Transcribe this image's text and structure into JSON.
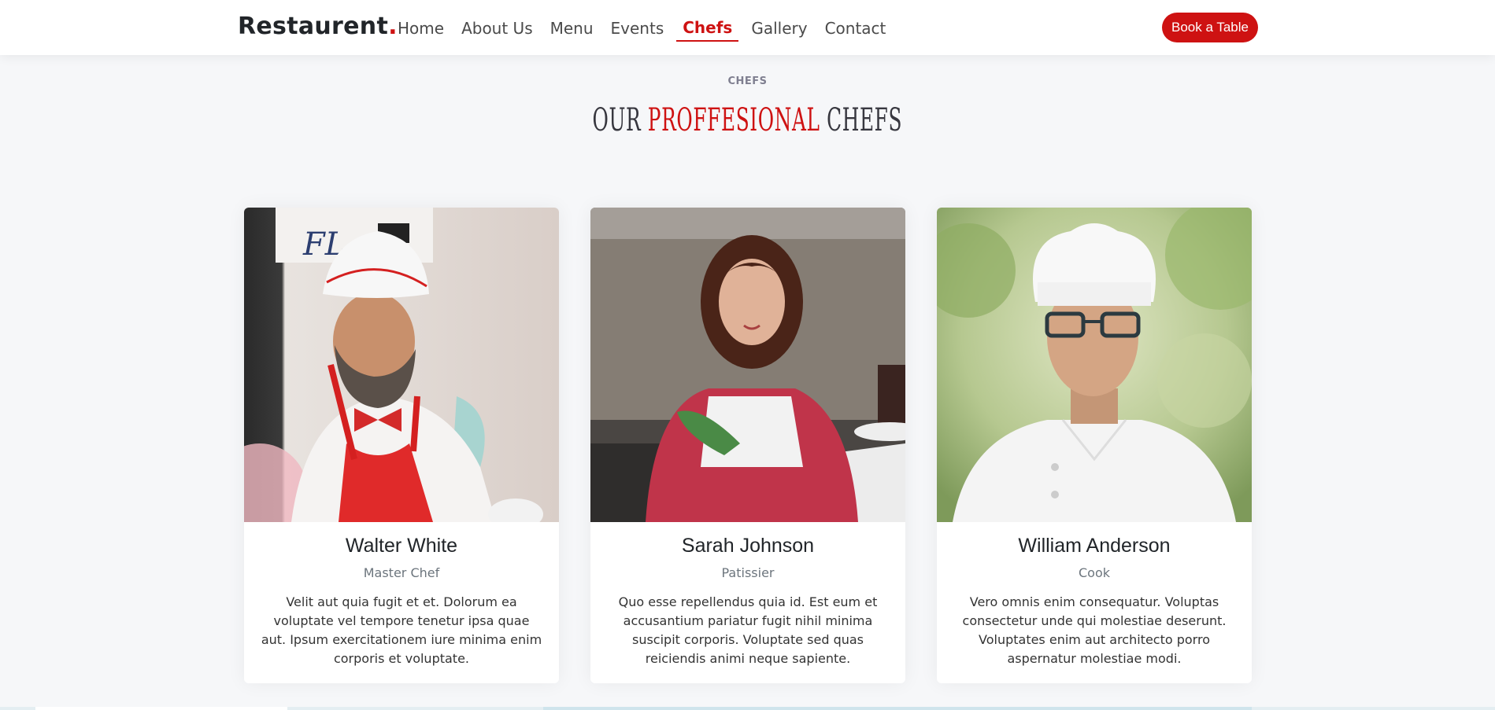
{
  "header": {
    "logo_text": "Restaurent",
    "logo_dot": ".",
    "nav": [
      {
        "label": "Home",
        "active": false
      },
      {
        "label": "About Us",
        "active": false
      },
      {
        "label": "Menu",
        "active": false
      },
      {
        "label": "Events",
        "active": false
      },
      {
        "label": "Chefs",
        "active": true
      },
      {
        "label": "Gallery",
        "active": false
      },
      {
        "label": "Contact",
        "active": false
      }
    ],
    "cta_label": "Book a Table"
  },
  "section": {
    "tag": "CHEFS",
    "title_part1": "OUR ",
    "title_accent": "PROFFESIONAL",
    "title_part2": " CHEFS"
  },
  "chefs": [
    {
      "name": "Walter White",
      "role": "Master Chef",
      "description": "Velit aut quia fugit et et. Dolorum ea voluptate vel tempore tenetur ipsa quae aut. Ipsum exercitationem iure minima enim corporis et voluptate."
    },
    {
      "name": "Sarah Johnson",
      "role": "Patissier",
      "description": "Quo esse repellendus quia id. Est eum et accusantium pariatur fugit nihil minima suscipit corporis. Voluptate sed quas reiciendis animi neque sapiente."
    },
    {
      "name": "William Anderson",
      "role": "Cook",
      "description": "Vero omnis enim consequatur. Voluptas consectetur unde qui molestiae deserunt. Voluptates enim aut architecto porro aspernatur molestiae modi."
    }
  ],
  "colors": {
    "accent": "#ce1212",
    "background": "#f6f7f9",
    "text_dark": "#212529",
    "text_muted": "#6c757d"
  }
}
